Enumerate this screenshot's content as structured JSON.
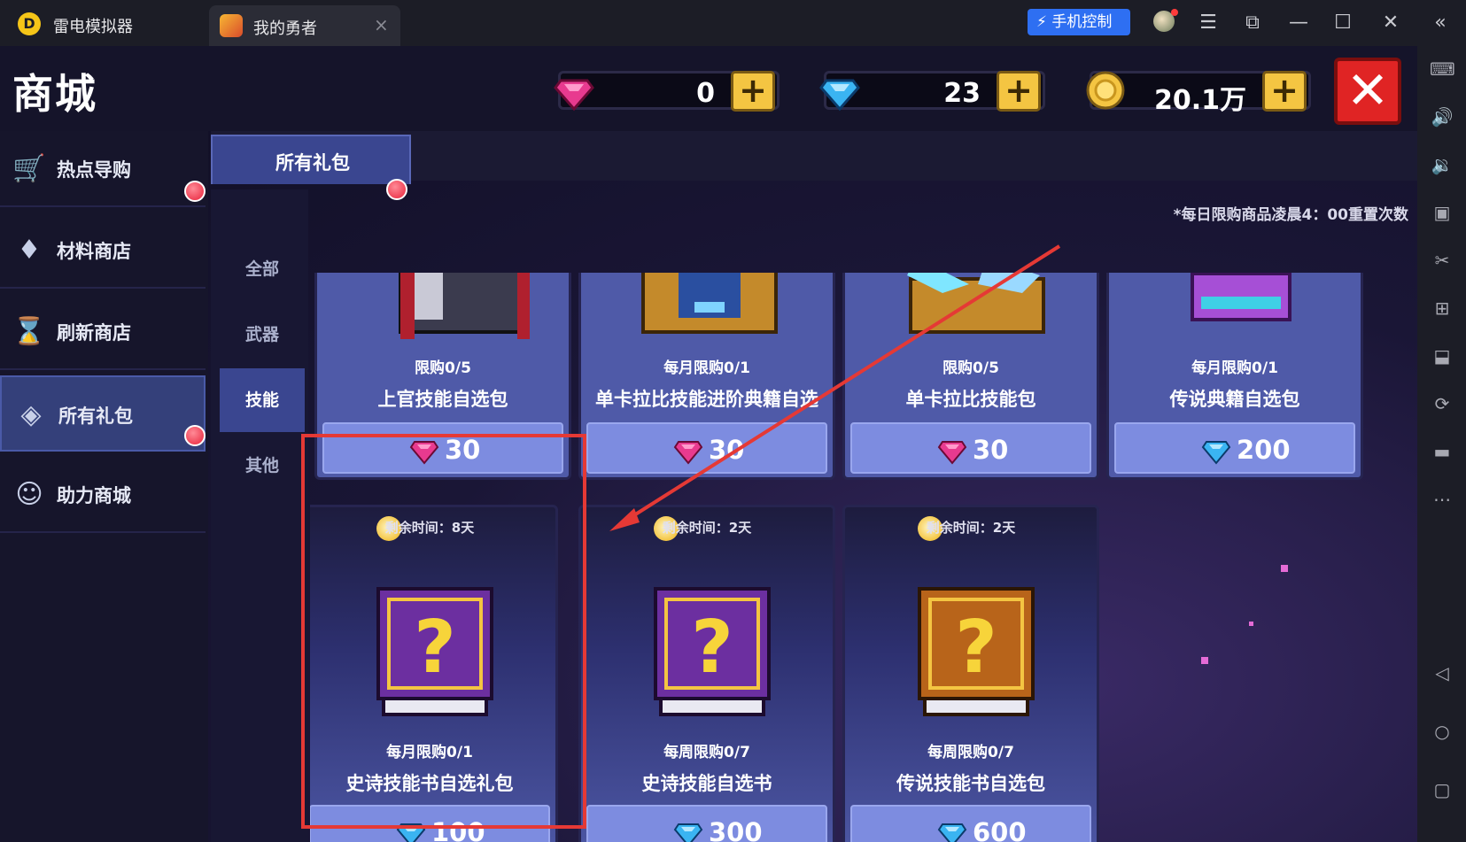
{
  "titlebar": {
    "app_name": "雷电模拟器",
    "tab_title": "我的勇者",
    "tab_close": "×",
    "phone_control": "手机控制",
    "minimize": "—",
    "maximize": "☐",
    "close": "✕",
    "collapse": "«",
    "menu": "☰",
    "restore": "⧉"
  },
  "header": {
    "title": "商城",
    "currencies": [
      {
        "name": "pink-gem",
        "value": "0",
        "color": "#e83a8f"
      },
      {
        "name": "blue-diamond",
        "value": "23",
        "color": "#3ab4f2"
      },
      {
        "name": "gold-coin",
        "value": "20.1万",
        "color": "#f4c542"
      }
    ],
    "plus": "+",
    "close": "✕"
  },
  "nav": {
    "items": [
      {
        "label": "热点导购",
        "icon": "cart-icon",
        "glyph": "🛒",
        "active": false
      },
      {
        "label": "材料商店",
        "icon": "gem-bag-icon",
        "glyph": "♦",
        "active": false
      },
      {
        "label": "刷新商店",
        "icon": "hourglass-icon",
        "glyph": "⌛",
        "active": false
      },
      {
        "label": "所有礼包",
        "icon": "diamond-icon",
        "glyph": "◈",
        "active": true
      },
      {
        "label": "助力商城",
        "icon": "helper-icon",
        "glyph": "☺",
        "active": false
      }
    ]
  },
  "tabs": {
    "main": "所有礼包",
    "sub": [
      "全部",
      "武器",
      "技能",
      "其他"
    ],
    "active_sub": "技能"
  },
  "notice": "*每日限购商品凌晨4：00重置次数",
  "products_top": [
    {
      "limit": "限购0/5",
      "name": "上官技能自选包",
      "currency": "pink-gem",
      "price": "30"
    },
    {
      "limit": "每月限购0/1",
      "name": "单卡拉比技能进阶典籍自选",
      "currency": "pink-gem",
      "price": "30"
    },
    {
      "limit": "限购0/5",
      "name": "单卡拉比技能包",
      "currency": "pink-gem",
      "price": "30"
    },
    {
      "limit": "每月限购0/1",
      "name": "传说典籍自选包",
      "currency": "blue-diamond",
      "price": "200"
    }
  ],
  "products_bottom": [
    {
      "timer": "剩余时间：8天",
      "limit": "每月限购0/1",
      "name": "史诗技能书自选礼包",
      "currency": "blue-diamond",
      "price": "100",
      "book": "purple"
    },
    {
      "timer": "剩余时间：2天",
      "limit": "每周限购0/7",
      "name": "史诗技能自选书",
      "currency": "blue-diamond",
      "price": "300",
      "book": "purple"
    },
    {
      "timer": "剩余时间：2天",
      "limit": "每周限购0/7",
      "name": "传说技能书自选包",
      "currency": "blue-diamond",
      "price": "600",
      "book": "orange"
    }
  ],
  "colors": {
    "accent": "#3a4690",
    "card": "#4f5aa8",
    "price_button": "#7d8ce0",
    "annotation": "#e53935"
  }
}
